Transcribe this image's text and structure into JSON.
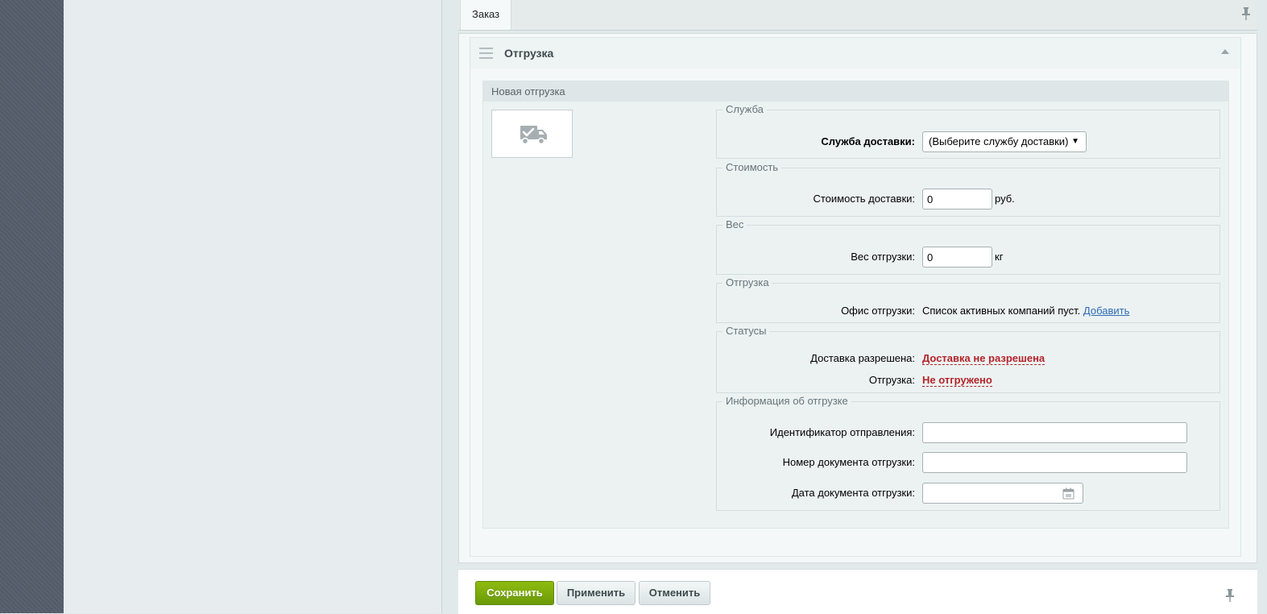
{
  "tabs": {
    "order": "Заказ"
  },
  "section": {
    "title": "Отгрузка",
    "shipment_title": "Новая отгрузка",
    "service": {
      "legend": "Служба",
      "label": "Служба доставки:",
      "selected": "(Выберите службу доставки)"
    },
    "cost": {
      "legend": "Стоимость",
      "label": "Стоимость доставки:",
      "value": "0",
      "unit": "руб."
    },
    "weight": {
      "legend": "Вес",
      "label": "Вес отгрузки:",
      "value": "0",
      "unit": "кг"
    },
    "shipping": {
      "legend": "Отгрузка",
      "label": "Офис отгрузки:",
      "text": "Список активных компаний пуст.",
      "link": "Добавить"
    },
    "statuses": {
      "legend": "Статусы",
      "delivery_label": "Доставка разрешена:",
      "delivery_value": "Доставка не разрешена",
      "shipment_label": "Отгрузка:",
      "shipment_value": "Не отгружено"
    },
    "info": {
      "legend": "Информация об отгрузке",
      "tracking_label": "Идентификатор отправления:",
      "tracking_value": "",
      "doc_number_label": "Номер документа отгрузки:",
      "doc_number_value": "",
      "doc_date_label": "Дата документа отгрузки:",
      "doc_date_value": ""
    }
  },
  "footer": {
    "save": "Сохранить",
    "apply": "Применить",
    "cancel": "Отменить"
  },
  "icons": {
    "pin": "pin-icon",
    "truck": "truck-check-icon",
    "calendar": "calendar-icon",
    "drag": "drag-handle-icon",
    "collapse": "collapse-arrow-icon"
  },
  "colors": {
    "save_button": "#7aab0b",
    "status_red": "#b5242a",
    "link": "#2d6bb5"
  }
}
